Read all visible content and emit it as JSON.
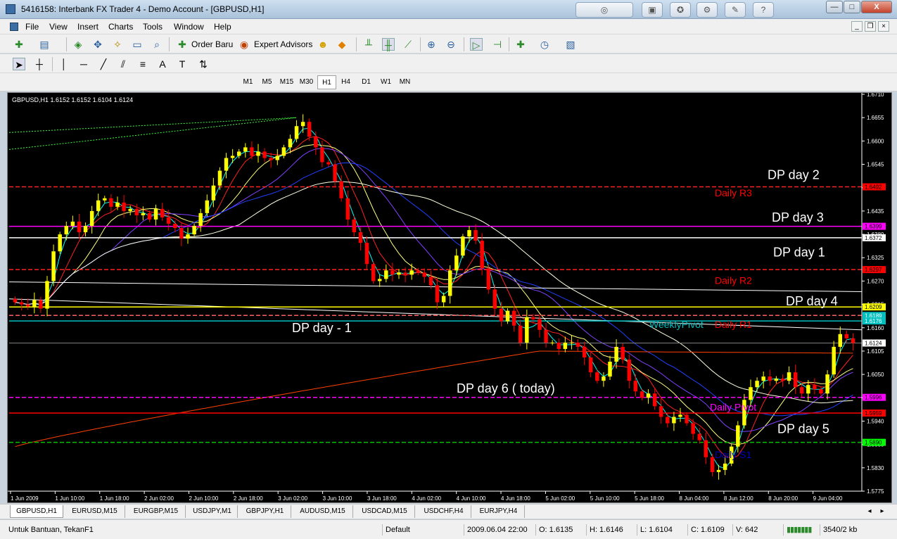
{
  "window": {
    "title": "5416158: Interbank FX Trader 4 - Demo Account - [GBPUSD,H1]",
    "min_label": "—",
    "max_label": "□",
    "close_label": "X"
  },
  "menu": [
    "File",
    "View",
    "Insert",
    "Charts",
    "Tools",
    "Window",
    "Help"
  ],
  "toolbar": {
    "order_label": "Order Baru",
    "experts_label": "Expert Advisors"
  },
  "timeframes": [
    "M1",
    "M5",
    "M15",
    "M30",
    "H1",
    "H4",
    "D1",
    "W1",
    "MN"
  ],
  "active_timeframe": "H1",
  "chart": {
    "header": "GBPUSD,H1  1.6152 1.6152 1.6104 1.6124",
    "background": "#000000",
    "bull_color": "#ffff00",
    "bear_color": "#ff0000",
    "y_ticks": [
      "1.6710",
      "1.6655",
      "1.6600",
      "1.6545",
      "1.6490",
      "1.6435",
      "1.6380",
      "1.6325",
      "1.6270",
      "1.6215",
      "1.6160",
      "1.6105",
      "1.6050",
      "1.5995",
      "1.5940",
      "1.5885",
      "1.5830",
      "1.5775"
    ],
    "x_ticks": [
      "1 Jun 2009",
      "1 Jun 10:00",
      "1 Jun 18:00",
      "2 Jun 02:00",
      "2 Jun 10:00",
      "2 Jun 18:00",
      "3 Jun 02:00",
      "3 Jun 10:00",
      "3 Jun 18:00",
      "4 Jun 02:00",
      "4 Jun 10:00",
      "4 Jun 18:00",
      "5 Jun 02:00",
      "5 Jun 10:00",
      "5 Jun 18:00",
      "8 Jun 04:00",
      "8 Jun 12:00",
      "8 Jun 20:00",
      "9 Jun 04:00"
    ],
    "price_labels": [
      {
        "text": "1.6492",
        "bg": "#ff0000",
        "fg": "#000000"
      },
      {
        "text": "1.6399",
        "bg": "#ff00ff",
        "fg": "#000000"
      },
      {
        "text": "1.6372",
        "bg": "#ffffff",
        "fg": "#000000"
      },
      {
        "text": "1.6297",
        "bg": "#ff0000",
        "fg": "#000000"
      },
      {
        "text": "1.6209",
        "bg": "#ffff00",
        "fg": "#000000"
      },
      {
        "text": "1.6189",
        "bg": "#00c0c0",
        "fg": "#ffffff"
      },
      {
        "text": "1.6176",
        "bg": "#00c0c0",
        "fg": "#ffffff"
      },
      {
        "text": "1.6124",
        "bg": "#ffffff",
        "fg": "#000000"
      },
      {
        "text": "1.5996",
        "bg": "#ff00ff",
        "fg": "#000000"
      },
      {
        "text": "1.5959",
        "bg": "#ff0000",
        "fg": "#000000"
      },
      {
        "text": "1.5890",
        "bg": "#00ff00",
        "fg": "#000000"
      }
    ],
    "annotations": [
      {
        "text": "DP day 2",
        "color": "#ffffff"
      },
      {
        "text": "DP day 3",
        "color": "#ffffff"
      },
      {
        "text": "DP day 1",
        "color": "#ffffff"
      },
      {
        "text": "DP day 4",
        "color": "#ffffff"
      },
      {
        "text": "DP day - 1",
        "color": "#ffffff"
      },
      {
        "text": "DP day 6 ( today)",
        "color": "#ffffff"
      },
      {
        "text": "DP day 5",
        "color": "#ffffff"
      },
      {
        "text": "Daily R3",
        "color": "#ff0000"
      },
      {
        "text": "Daily R2",
        "color": "#ff0000"
      },
      {
        "text": "Daily R1",
        "color": "#ff0000"
      },
      {
        "text": "WeeklyPivot",
        "color": "#00c0c0"
      },
      {
        "text": "Daily Pivot",
        "color": "#ff00ff"
      },
      {
        "text": "Daily S1",
        "color": "#0000c0"
      }
    ]
  },
  "chart_data": {
    "type": "candlestick",
    "title": "GBPUSD,H1",
    "ohlc_last": {
      "open": 1.6152,
      "high": 1.6152,
      "low": 1.6104,
      "close": 1.6124
    },
    "ylim": [
      1.5775,
      1.671
    ],
    "x_labels": [
      "1 Jun 2009",
      "1 Jun 10:00",
      "1 Jun 18:00",
      "2 Jun 02:00",
      "2 Jun 10:00",
      "2 Jun 18:00",
      "3 Jun 02:00",
      "3 Jun 10:00",
      "3 Jun 18:00",
      "4 Jun 02:00",
      "4 Jun 10:00",
      "4 Jun 18:00",
      "5 Jun 02:00",
      "5 Jun 10:00",
      "5 Jun 18:00",
      "8 Jun 04:00",
      "8 Jun 12:00",
      "8 Jun 20:00",
      "9 Jun 04:00"
    ],
    "closes": [
      1.622,
      1.6215,
      1.621,
      1.6225,
      1.6205,
      1.627,
      1.634,
      1.638,
      1.64,
      1.641,
      1.6385,
      1.64,
      1.6435,
      1.646,
      1.6465,
      1.6445,
      1.6455,
      1.6435,
      1.644,
      1.6425,
      1.643,
      1.6415,
      1.644,
      1.642,
      1.6405,
      1.6395,
      1.637,
      1.638,
      1.64,
      1.643,
      1.646,
      1.6495,
      1.653,
      1.656,
      1.6565,
      1.6575,
      1.6585,
      1.6565,
      1.6575,
      1.656,
      1.6555,
      1.6565,
      1.6585,
      1.6605,
      1.6635,
      1.6645,
      1.661,
      1.6585,
      1.655,
      1.6545,
      1.6505,
      1.6465,
      1.6415,
      1.6385,
      1.636,
      1.631,
      1.627,
      1.6275,
      1.6295,
      1.6285,
      1.629,
      1.6285,
      1.6295,
      1.629,
      1.628,
      1.626,
      1.622,
      1.6235,
      1.6295,
      1.633,
      1.6375,
      1.639,
      1.6365,
      1.63,
      1.625,
      1.6205,
      1.6175,
      1.62,
      1.6165,
      1.6125,
      1.6185,
      1.618,
      1.6155,
      1.6125,
      1.6125,
      1.611,
      1.6125,
      1.6125,
      1.6115,
      1.609,
      1.6055,
      1.6035,
      1.6045,
      1.608,
      1.6115,
      1.6085,
      1.6035,
      1.601,
      1.5995,
      1.6005,
      1.5975,
      1.595,
      1.5935,
      1.595,
      1.5955,
      1.5935,
      1.591,
      1.5895,
      1.5855,
      1.582,
      1.5825,
      1.584,
      1.588,
      1.593,
      1.599,
      1.602,
      1.6035,
      1.6045,
      1.6035,
      1.604,
      1.6035,
      1.6055,
      1.602,
      1.6005,
      1.6025,
      1.6015,
      1.6005,
      1.605,
      1.6115,
      1.6145,
      1.6135,
      1.6124
    ],
    "levels": [
      {
        "name": "Daily R3",
        "value": 1.6492
      },
      {
        "name": "DP day 3",
        "value": 1.6399
      },
      {
        "name": "DP day 1",
        "value": 1.6372
      },
      {
        "name": "Daily R2",
        "value": 1.6297
      },
      {
        "name": "DP day 4",
        "value": 1.6209
      },
      {
        "name": "Daily R1",
        "value": 1.6189
      },
      {
        "name": "WeeklyPivot",
        "value": 1.6176
      },
      {
        "name": "Daily Pivot",
        "value": 1.5996
      },
      {
        "name": "DP day 5",
        "value": 1.5959
      },
      {
        "name": "Daily S1",
        "value": 1.589
      }
    ]
  },
  "symbol_tabs": [
    "GBPUSD,H1",
    "EURUSD,M15",
    "EURGBP,M15",
    "USDJPY,M1",
    "GBPJPY,H1",
    "AUDUSD,M15",
    "USDCAD,M15",
    "USDCHF,H4",
    "EURJPY,H4"
  ],
  "status": {
    "help": "Untuk Bantuan, TekanF1",
    "profile": "Default",
    "datetime": "2009.06.04 22:00",
    "open": "O: 1.6135",
    "high": "H: 1.6146",
    "low": "L: 1.6104",
    "close": "C: 1.6109",
    "volume": "V: 642",
    "traffic": "3540/2 kb"
  }
}
